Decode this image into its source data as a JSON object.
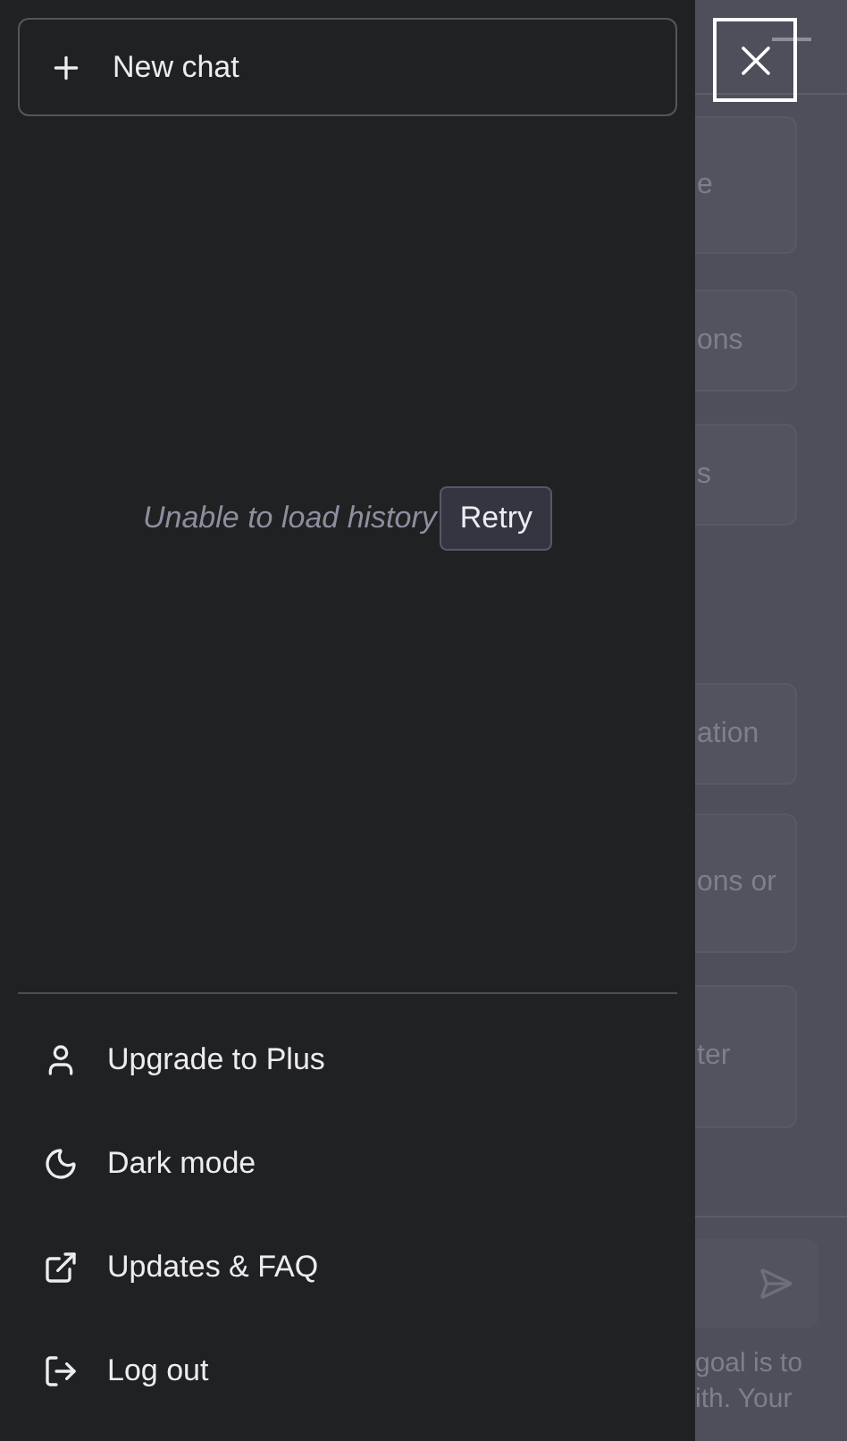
{
  "drawer": {
    "new_chat": "New chat",
    "history_error": "Unable to load history",
    "retry": "Retry",
    "menu": [
      {
        "kind": "user",
        "label": "Upgrade to Plus"
      },
      {
        "kind": "moon",
        "label": "Dark mode"
      },
      {
        "kind": "external",
        "label": "Updates & FAQ"
      },
      {
        "kind": "logout",
        "label": "Log out"
      }
    ]
  },
  "background": {
    "cards": [
      {
        "lines": [
          "e"
        ]
      },
      {
        "lines": [
          "ons"
        ]
      },
      {
        "lines": [
          "s"
        ]
      },
      {
        "lines": [
          "ation"
        ]
      },
      {
        "lines": [
          "ons or"
        ]
      },
      {
        "lines": [
          "ter"
        ]
      }
    ],
    "footer_lines": [
      "goal is to",
      "ith. Your"
    ]
  }
}
